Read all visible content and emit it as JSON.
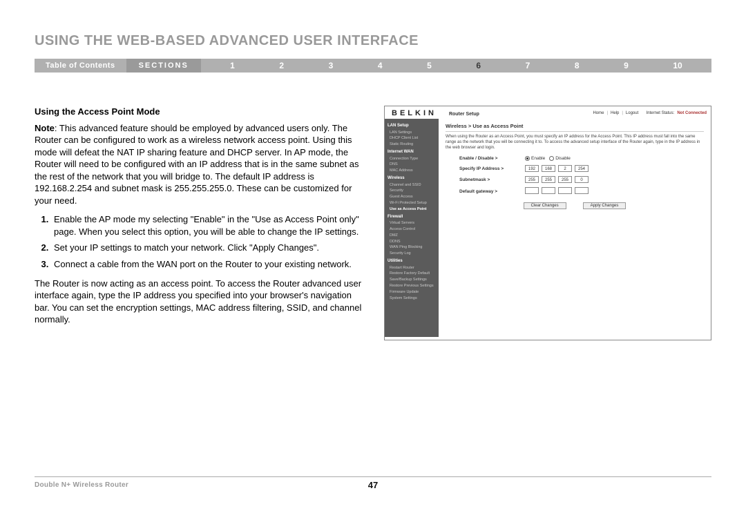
{
  "header": {
    "title": "USING THE WEB-BASED ADVANCED USER INTERFACE"
  },
  "nav": {
    "toc": "Table of Contents",
    "sections_label": "SECTIONS",
    "numbers": [
      "1",
      "2",
      "3",
      "4",
      "5",
      "6",
      "7",
      "8",
      "9",
      "10"
    ],
    "current": "6"
  },
  "body": {
    "subhead": "Using the Access Point Mode",
    "note_label": "Note",
    "note_text": ": This advanced feature should be employed by advanced users only. The Router can be configured to work as a wireless network access point. Using this mode will defeat the NAT IP sharing feature and DHCP server. In AP mode, the Router will need to be configured with an IP address that is in the same subnet as the rest of the network that you will bridge to. The default IP address is 192.168.2.254 and subnet mask is 255.255.255.0. These can be customized for your need.",
    "steps": [
      "Enable the AP mode my selecting \"Enable\" in the \"Use as Access Point only\" page. When you select this option, you will be able to change the IP settings.",
      "Set your IP settings to match your network. Click \"Apply Changes\".",
      "Connect a cable from the WAN port on the Router to your existing network."
    ],
    "followup": "The Router is now acting as an access point. To access the Router advanced user interface again, type the IP address you specified into your browser's navigation bar. You can set the encryption settings, MAC address filtering, SSID, and channel normally."
  },
  "screenshot": {
    "brand": "BELKIN",
    "router_setup_label": "Router Setup",
    "links": {
      "home": "Home",
      "help": "Help",
      "logout": "Logout"
    },
    "internet_status_label": "Internet Status:",
    "internet_status_value": "Not Connected",
    "sidebar": {
      "lan_setup": "LAN Setup",
      "lan_items": [
        "LAN Settings",
        "DHCP Client List",
        "Static Routing"
      ],
      "internet_wan": "Internet WAN",
      "wan_items": [
        "Connection Type",
        "DNS",
        "MAC Address"
      ],
      "wireless": "Wireless",
      "wireless_items": [
        "Channel and SSID",
        "Security",
        "Guest Access",
        "Wi-Fi Protected Setup",
        "Use as Access Point"
      ],
      "firewall": "Firewall",
      "firewall_items": [
        "Virtual Servers",
        "Access Control",
        "DMZ",
        "DDNS",
        "WAN Ping Blocking",
        "Security Log"
      ],
      "utilities": "Utilities",
      "util_items": [
        "Restart Router",
        "Restore Factory Default",
        "Save/Backup Settings",
        "Restore Previous Settings",
        "Firmware Update",
        "System Settings"
      ]
    },
    "main": {
      "breadcrumb": "Wireless > Use as Access Point",
      "desc": "When using the Router as an Access Point, you must specify an IP address for the Access Point. This IP address must fall into the same range as the network that you will be connecting it to. To access the advanced setup interface of the Router again, type in the IP address in the web browser and login.",
      "fields": {
        "enable_label": "Enable / Disable >",
        "enable_opt": "Enable",
        "disable_opt": "Disable",
        "ip_label": "Specify IP Address >",
        "ip": [
          "192",
          "168",
          "2",
          "254"
        ],
        "subnet_label": "Subnetmask >",
        "subnet": [
          "255",
          "255",
          "255",
          "0"
        ],
        "gw_label": "Default gateway >",
        "gw": [
          "",
          "",
          "",
          ""
        ]
      },
      "btn_clear": "Clear Changes",
      "btn_apply": "Apply Changes"
    }
  },
  "footer": {
    "product": "Double N+ Wireless Router",
    "page": "47"
  }
}
